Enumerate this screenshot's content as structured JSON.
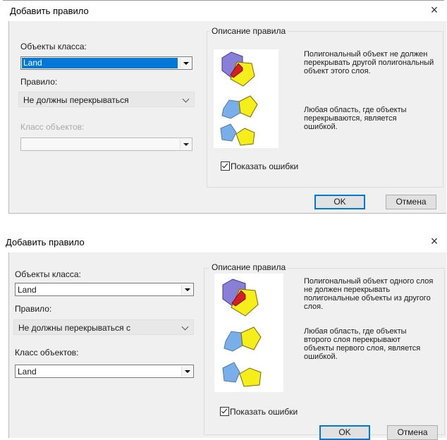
{
  "dialog1": {
    "title": "Добавить правило",
    "close_glyph": "×",
    "feature_class_label": "Объекты класса:",
    "feature_class_value": "Land",
    "rule_label": "Правило:",
    "rule_value": "Не должны перекрываться",
    "other_class_label": "Класс объектов:",
    "other_class_value": "",
    "group_title": "Описание правила",
    "description_1": "Полигональный объект не должен перекрывать другой полигональный объект этого слоя.",
    "description_2": "Любая область, где объекты перекрываются, является ошибкой.",
    "show_errors_label": "Показать ошибки",
    "show_errors_checked": true,
    "ok_label": "OK",
    "cancel_label": "Отмена"
  },
  "dialog2": {
    "title": "Добавить правило",
    "close_glyph": "×",
    "feature_class_label": "Объекты класса:",
    "feature_class_value": "Land",
    "rule_label": "Правило:",
    "rule_value": "Не должны перекрываться с",
    "other_class_label": "Класс объектов:",
    "other_class_value": "Land",
    "group_title": "Описание правила",
    "description_1": "Полигональный объект одного слоя не должен перекрывать полигональные объекты из другого слоя.",
    "description_2": "Любая область, где объекты второго слоя перекрывают объекты первого слоя, является ошибкой.",
    "show_errors_label": "Показать ошибки",
    "show_errors_checked": true,
    "ok_label": "OK",
    "cancel_label": "Отмена"
  },
  "colors": {
    "polygon_blue": "#7aaee8",
    "polygon_purple": "#8a7fd6",
    "polygon_yellow": "#f5ee1a",
    "overlap_red": "#d42020",
    "selection": "#0078d7"
  }
}
